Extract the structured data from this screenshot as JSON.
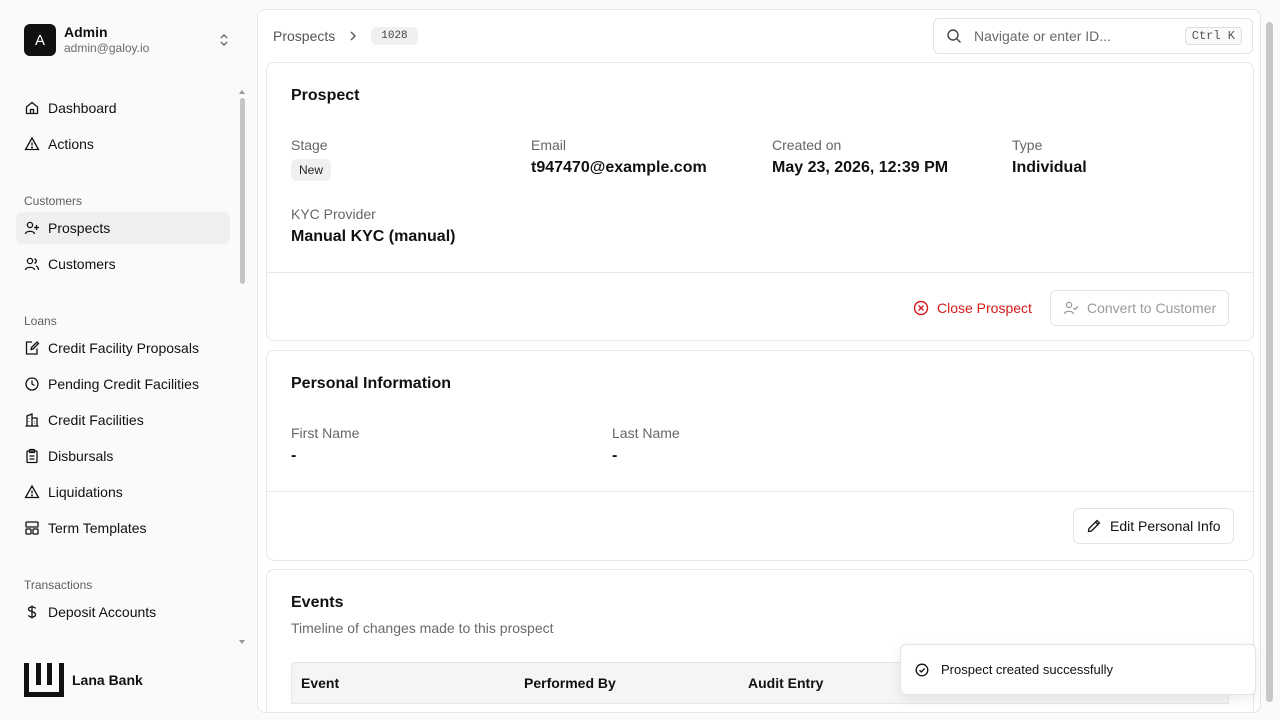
{
  "user": {
    "initial": "A",
    "name": "Admin",
    "email": "admin@galoy.io"
  },
  "nav": {
    "top": [
      {
        "label": "Dashboard",
        "icon": "home-icon"
      },
      {
        "label": "Actions",
        "icon": "alert-triangle-icon"
      }
    ],
    "customers_group": "Customers",
    "customers": [
      {
        "label": "Prospects",
        "icon": "user-plus-icon",
        "active": true
      },
      {
        "label": "Customers",
        "icon": "users-icon"
      }
    ],
    "loans_group": "Loans",
    "loans": [
      {
        "label": "Credit Facility Proposals",
        "icon": "edit-doc-icon"
      },
      {
        "label": "Pending Credit Facilities",
        "icon": "clock-icon"
      },
      {
        "label": "Credit Facilities",
        "icon": "building-icon"
      },
      {
        "label": "Disbursals",
        "icon": "clipboard-icon"
      },
      {
        "label": "Liquidations",
        "icon": "alert-triangle-icon"
      },
      {
        "label": "Term Templates",
        "icon": "layout-icon"
      }
    ],
    "transactions_group": "Transactions",
    "transactions": [
      {
        "label": "Deposit Accounts",
        "icon": "dollar-icon"
      }
    ]
  },
  "brand": {
    "name": "Lana Bank"
  },
  "breadcrumb": {
    "root": "Prospects",
    "id": "1028"
  },
  "search": {
    "placeholder": "Navigate or enter ID...",
    "shortcut": "Ctrl K"
  },
  "prospect": {
    "title": "Prospect",
    "stage_label": "Stage",
    "stage_value": "New",
    "email_label": "Email",
    "email_value": "t947470@example.com",
    "created_label": "Created on",
    "created_value": "May 23, 2026, 12:39 PM",
    "type_label": "Type",
    "type_value": "Individual",
    "kyc_label": "KYC Provider",
    "kyc_value": "Manual KYC (manual)",
    "close_button": "Close Prospect",
    "convert_button": "Convert to Customer"
  },
  "personal": {
    "title": "Personal Information",
    "first_label": "First Name",
    "first_value": "-",
    "last_label": "Last Name",
    "last_value": "-",
    "edit_button": "Edit Personal Info"
  },
  "events": {
    "title": "Events",
    "subtitle": "Timeline of changes made to this prospect",
    "columns": [
      "Event",
      "Performed By",
      "Audit Entry"
    ]
  },
  "toast": {
    "message": "Prospect created successfully"
  },
  "colors": {
    "danger": "#d61a1a",
    "active_bg": "#efefef"
  }
}
